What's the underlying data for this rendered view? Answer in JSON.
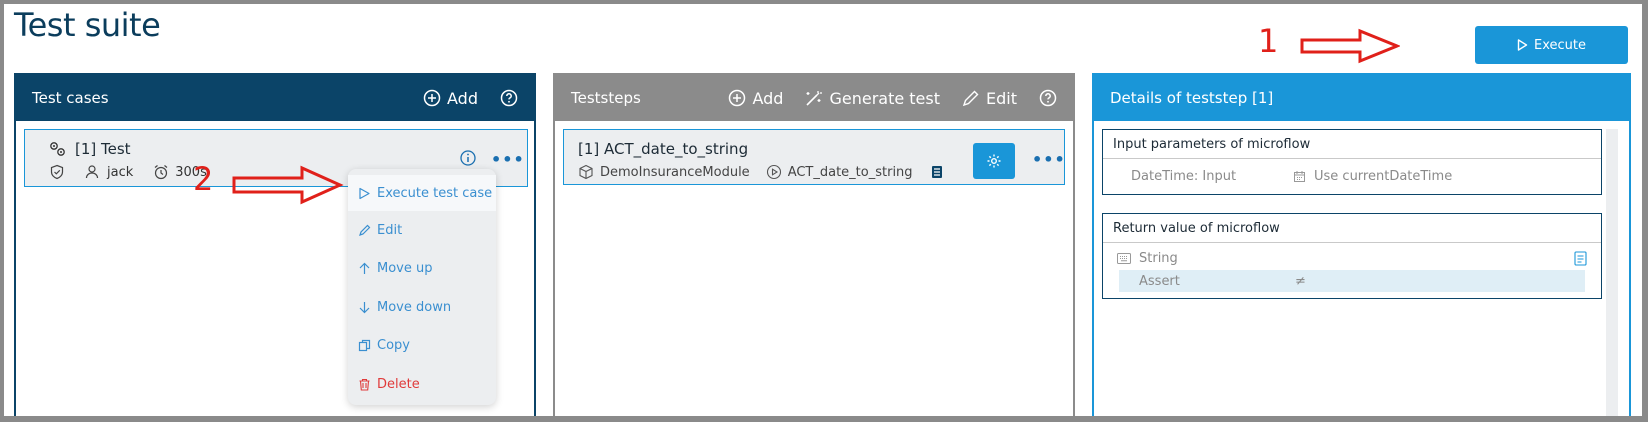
{
  "page": {
    "title": "Test suite"
  },
  "execute_button": {
    "label": "Execute"
  },
  "callouts": {
    "one": "1",
    "two": "2"
  },
  "test_cases_panel": {
    "title": "Test cases",
    "add_label": "Add",
    "case": {
      "title": "[1] Test",
      "user": "jack",
      "timeout": "300s"
    },
    "menu": {
      "execute": "Execute test case",
      "edit": "Edit",
      "move_up": "Move up",
      "move_down": "Move down",
      "copy": "Copy",
      "delete": "Delete"
    }
  },
  "teststeps_panel": {
    "title": "Teststeps",
    "add_label": "Add",
    "generate_label": "Generate test",
    "edit_label": "Edit",
    "step": {
      "title": "[1] ACT_date_to_string",
      "module": "DemoInsuranceModule",
      "microflow": "ACT_date_to_string"
    }
  },
  "details_panel": {
    "title": "Details of teststep [1]",
    "input_section": {
      "title": "Input parameters of microflow",
      "param_name": "DateTime: Input",
      "param_value": "Use currentDateTime"
    },
    "return_section": {
      "title": "Return value of microflow",
      "type": "String",
      "assert_label": "Assert",
      "assert_operator": "≠"
    }
  },
  "colors": {
    "primary_dark": "#0b4468",
    "accent": "#1a96d8",
    "neutral_header": "#8b8b8b",
    "danger": "#e03b3b",
    "callout": "#e0201a"
  }
}
